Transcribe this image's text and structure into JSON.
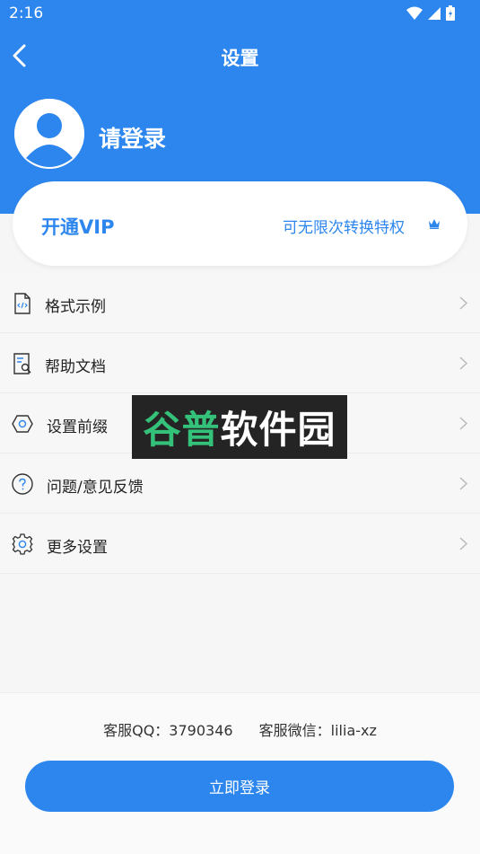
{
  "status_bar": {
    "time": "2:16"
  },
  "header": {
    "title": "设置",
    "login_prompt": "请登录"
  },
  "vip": {
    "title": "开通VIP",
    "description": "可无限次转换特权"
  },
  "menu": {
    "items": [
      {
        "label": "格式示例",
        "icon": "file-code-icon"
      },
      {
        "label": "帮助文档",
        "icon": "document-search-icon"
      },
      {
        "label": "设置前缀",
        "icon": "hexagon-icon"
      },
      {
        "label": "问题/意见反馈",
        "icon": "question-circle-icon"
      },
      {
        "label": "更多设置",
        "icon": "gear-icon"
      }
    ]
  },
  "footer": {
    "qq": "客服QQ：3790346",
    "wechat": "客服微信：lilia-xz",
    "login_button": "立即登录"
  },
  "watermark": {
    "text_green": "谷普",
    "text_white": "软件园"
  },
  "colors": {
    "primary": "#2c86ee",
    "background": "#f6f6f6"
  }
}
